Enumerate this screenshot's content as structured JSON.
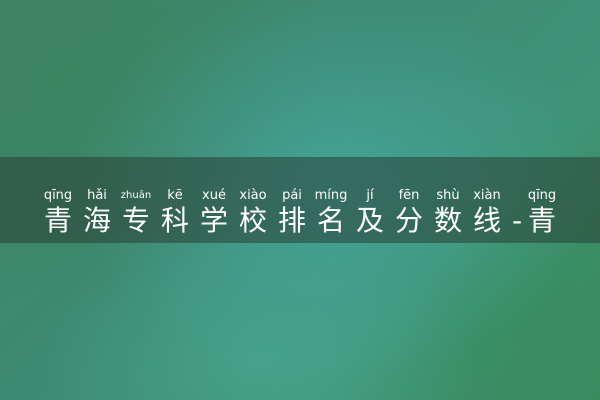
{
  "title": {
    "characters": [
      {
        "pinyin": "qīng",
        "hanzi": "青"
      },
      {
        "pinyin": "hǎi",
        "hanzi": "海"
      },
      {
        "pinyin": "zhuān",
        "hanzi": "专"
      },
      {
        "pinyin": "kē",
        "hanzi": "科"
      },
      {
        "pinyin": "xué",
        "hanzi": "学"
      },
      {
        "pinyin": "xiào",
        "hanzi": "校"
      },
      {
        "pinyin": "pái",
        "hanzi": "排"
      },
      {
        "pinyin": "míng",
        "hanzi": "名"
      },
      {
        "pinyin": "jí",
        "hanzi": "及"
      },
      {
        "pinyin": "fēn",
        "hanzi": "分"
      },
      {
        "pinyin": "shù",
        "hanzi": "数"
      },
      {
        "pinyin": "xiàn",
        "hanzi": "线"
      },
      {
        "pinyin": "",
        "hanzi": "-"
      },
      {
        "pinyin": "qīng",
        "hanzi": "青"
      }
    ]
  }
}
